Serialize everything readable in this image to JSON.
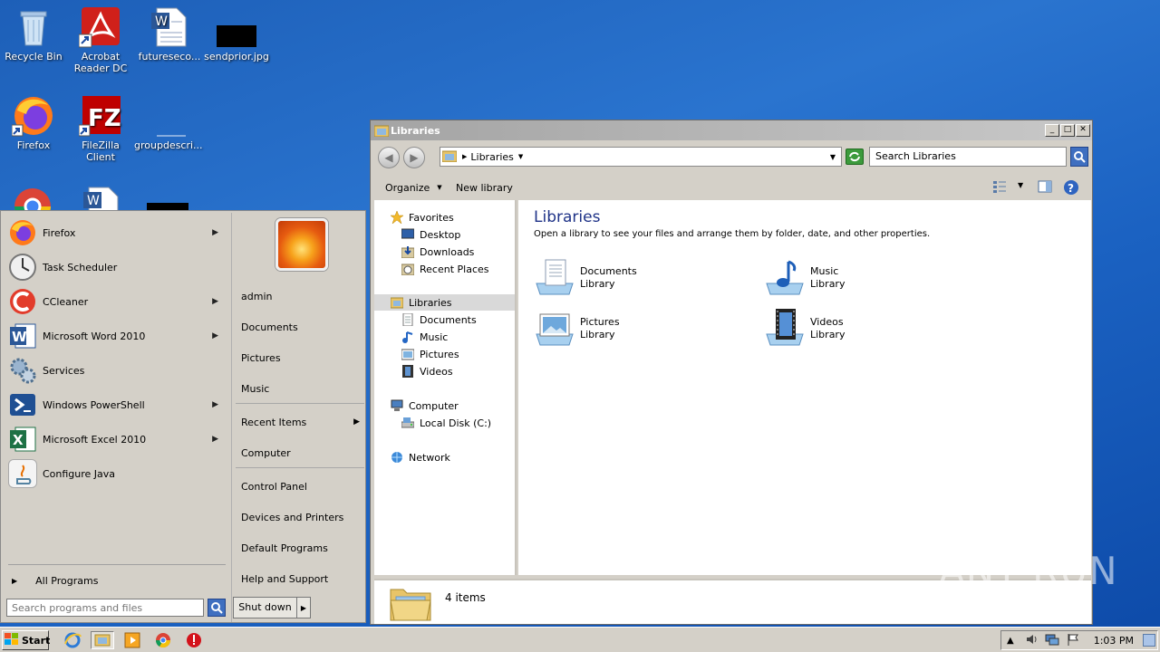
{
  "desktop": {
    "icons": [
      {
        "label": "Recycle Bin",
        "icon": "recycle-bin-icon"
      },
      {
        "label": "Acrobat Reader DC",
        "icon": "acrobat-icon"
      },
      {
        "label": "futureseco...",
        "icon": "word-doc-icon"
      },
      {
        "label": "sendprior.jpg",
        "icon": "image-file-icon"
      },
      {
        "label": "Firefox",
        "icon": "firefox-icon"
      },
      {
        "label": "FileZilla Client",
        "icon": "filezilla-icon"
      },
      {
        "label": "groupdescri...",
        "icon": "blank-file-icon"
      }
    ]
  },
  "start_menu": {
    "programs": [
      {
        "label": "Firefox",
        "icon": "firefox-icon",
        "submenu": true
      },
      {
        "label": "Task Scheduler",
        "icon": "clock-icon",
        "submenu": false
      },
      {
        "label": "CCleaner",
        "icon": "ccleaner-icon",
        "submenu": true
      },
      {
        "label": "Microsoft Word 2010",
        "icon": "word-icon",
        "submenu": true
      },
      {
        "label": "Services",
        "icon": "gears-icon",
        "submenu": false
      },
      {
        "label": "Windows PowerShell",
        "icon": "powershell-icon",
        "submenu": true
      },
      {
        "label": "Microsoft Excel 2010",
        "icon": "excel-icon",
        "submenu": true
      },
      {
        "label": "Configure Java",
        "icon": "java-icon",
        "submenu": false
      }
    ],
    "all_programs": "All Programs",
    "search_placeholder": "Search programs and files",
    "right_items": [
      {
        "label": "admin"
      },
      {
        "label": "Documents"
      },
      {
        "label": "Pictures"
      },
      {
        "label": "Music"
      },
      {
        "label": "Recent Items",
        "submenu": true
      },
      {
        "label": "Computer"
      },
      {
        "label": "Control Panel"
      },
      {
        "label": "Devices and Printers"
      },
      {
        "label": "Default Programs"
      },
      {
        "label": "Help and Support"
      }
    ],
    "shutdown_label": "Shut down"
  },
  "explorer": {
    "title": "Libraries",
    "address_label": "Libraries",
    "search_placeholder": "Search Libraries",
    "toolbar": {
      "organize": "Organize",
      "new_library": "New library"
    },
    "nav": {
      "favorites": "Favorites",
      "desktop": "Desktop",
      "downloads": "Downloads",
      "recent_places": "Recent Places",
      "libraries": "Libraries",
      "documents": "Documents",
      "music": "Music",
      "pictures": "Pictures",
      "videos": "Videos",
      "computer": "Computer",
      "local_disk": "Local Disk (C:)",
      "network": "Network"
    },
    "content": {
      "heading": "Libraries",
      "subheading": "Open a library to see your files and arrange them by folder, date, and other properties.",
      "libraries": [
        {
          "name": "Documents",
          "type": "Library",
          "icon": "documents-library-icon"
        },
        {
          "name": "Music",
          "type": "Library",
          "icon": "music-library-icon"
        },
        {
          "name": "Pictures",
          "type": "Library",
          "icon": "pictures-library-icon"
        },
        {
          "name": "Videos",
          "type": "Library",
          "icon": "videos-library-icon"
        }
      ]
    },
    "details": {
      "count": "4 items"
    }
  },
  "taskbar": {
    "start_label": "Start",
    "clock": "1:03 PM"
  },
  "watermark": "ANY RUN"
}
